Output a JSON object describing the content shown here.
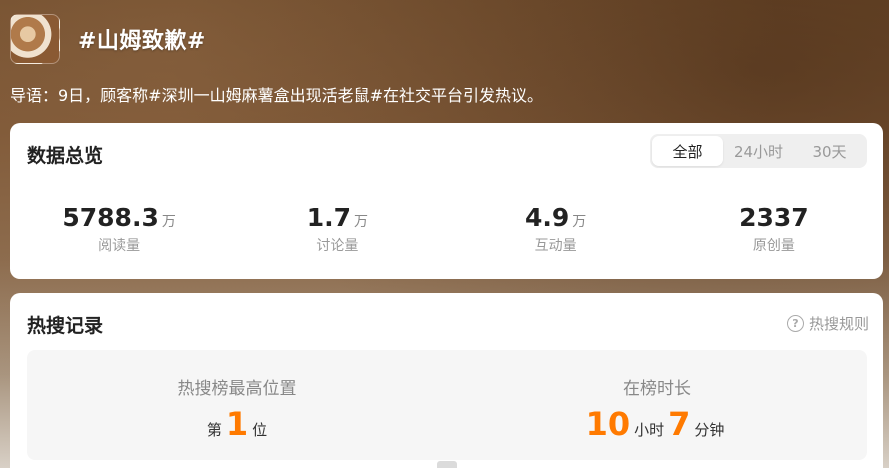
{
  "topic": {
    "title": "#山姆致歉#",
    "intro": "导语：9日，顾客称#深圳一山姆麻薯盒出现活老鼠#在社交平台引发热议。"
  },
  "overview": {
    "title": "数据总览",
    "tabs": [
      {
        "label": "全部",
        "active": true
      },
      {
        "label": "24小时",
        "active": false
      },
      {
        "label": "30天",
        "active": false
      }
    ],
    "stats": [
      {
        "value": "5788.3",
        "unit": "万",
        "label": "阅读量"
      },
      {
        "value": "1.7",
        "unit": "万",
        "label": "讨论量"
      },
      {
        "value": "4.9",
        "unit": "万",
        "label": "互动量"
      },
      {
        "value": "2337",
        "unit": "",
        "label": "原创量"
      }
    ]
  },
  "hot": {
    "title": "热搜记录",
    "rules_label": "热搜规则",
    "peak": {
      "title": "热搜榜最高位置",
      "prefix": "第",
      "value": "1",
      "suffix": "位"
    },
    "duration": {
      "title": "在榜时长",
      "hours": "10",
      "hours_unit": "小时",
      "minutes": "7",
      "minutes_unit": "分钟"
    }
  },
  "colors": {
    "accent": "#ff7a00",
    "card_bg": "#ffffff"
  },
  "icons": {
    "rules": "question-circle-icon"
  }
}
